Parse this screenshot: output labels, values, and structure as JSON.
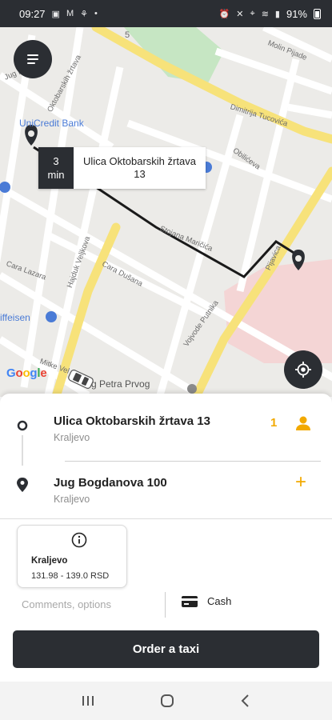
{
  "status_bar": {
    "time": "09:27",
    "battery": "91%"
  },
  "map": {
    "streets": {
      "bank": "UniCredit Bank",
      "raiffeisen": "iffeisen",
      "street_5": "5",
      "dimitrija": "Dimitrija Tucovića",
      "jug_b": "Jug B",
      "oktobarskih": "Oktobarskih žrtava",
      "obilicev": "Obilićeva",
      "hajduk": "Hajduk Veljkova",
      "cara_lazara": "Cara Lazara",
      "cara_dusana": "Cara Dušana",
      "vojvode": "Vojvode Putnika",
      "mitke": "Mitke Vel",
      "kralja": "Kralja Petra Prvog",
      "petra": "g Petra Prvog",
      "molin": "Molin Pijade",
      "stojana": "Stojana Maričića",
      "pijavica": "Pijavica"
    },
    "google_logo": "Google",
    "eta": {
      "value": "3",
      "unit": "min"
    },
    "pickup_callout": "Ulica Oktobarskih žrtava 13"
  },
  "route": {
    "pickup": {
      "title": "Ulica Oktobarskih žrtava 13",
      "city": "Kraljevo"
    },
    "passengers": "1",
    "dropoff": {
      "title": "Jug Bogdanova 100",
      "city": "Kraljevo"
    },
    "add_stop": "+"
  },
  "tariff": {
    "name": "Kraljevo",
    "price": "131.98 - 139.0 RSD"
  },
  "comments_placeholder": "Comments, options",
  "payment": {
    "method": "Cash"
  },
  "order_button": "Order a taxi",
  "colors": {
    "dark": "#2b2e33",
    "accent": "#f2a900",
    "road_major": "#f7e27a",
    "park": "#c6e6c3",
    "hospital": "#f4d5d5"
  },
  "icons": {
    "menu": "menu-icon",
    "locate": "locate-icon",
    "pickup": "pickup-circle-icon",
    "dropoff": "dropoff-pin-icon",
    "passenger": "person-icon",
    "info": "info-icon",
    "payment": "cash-card-icon"
  }
}
